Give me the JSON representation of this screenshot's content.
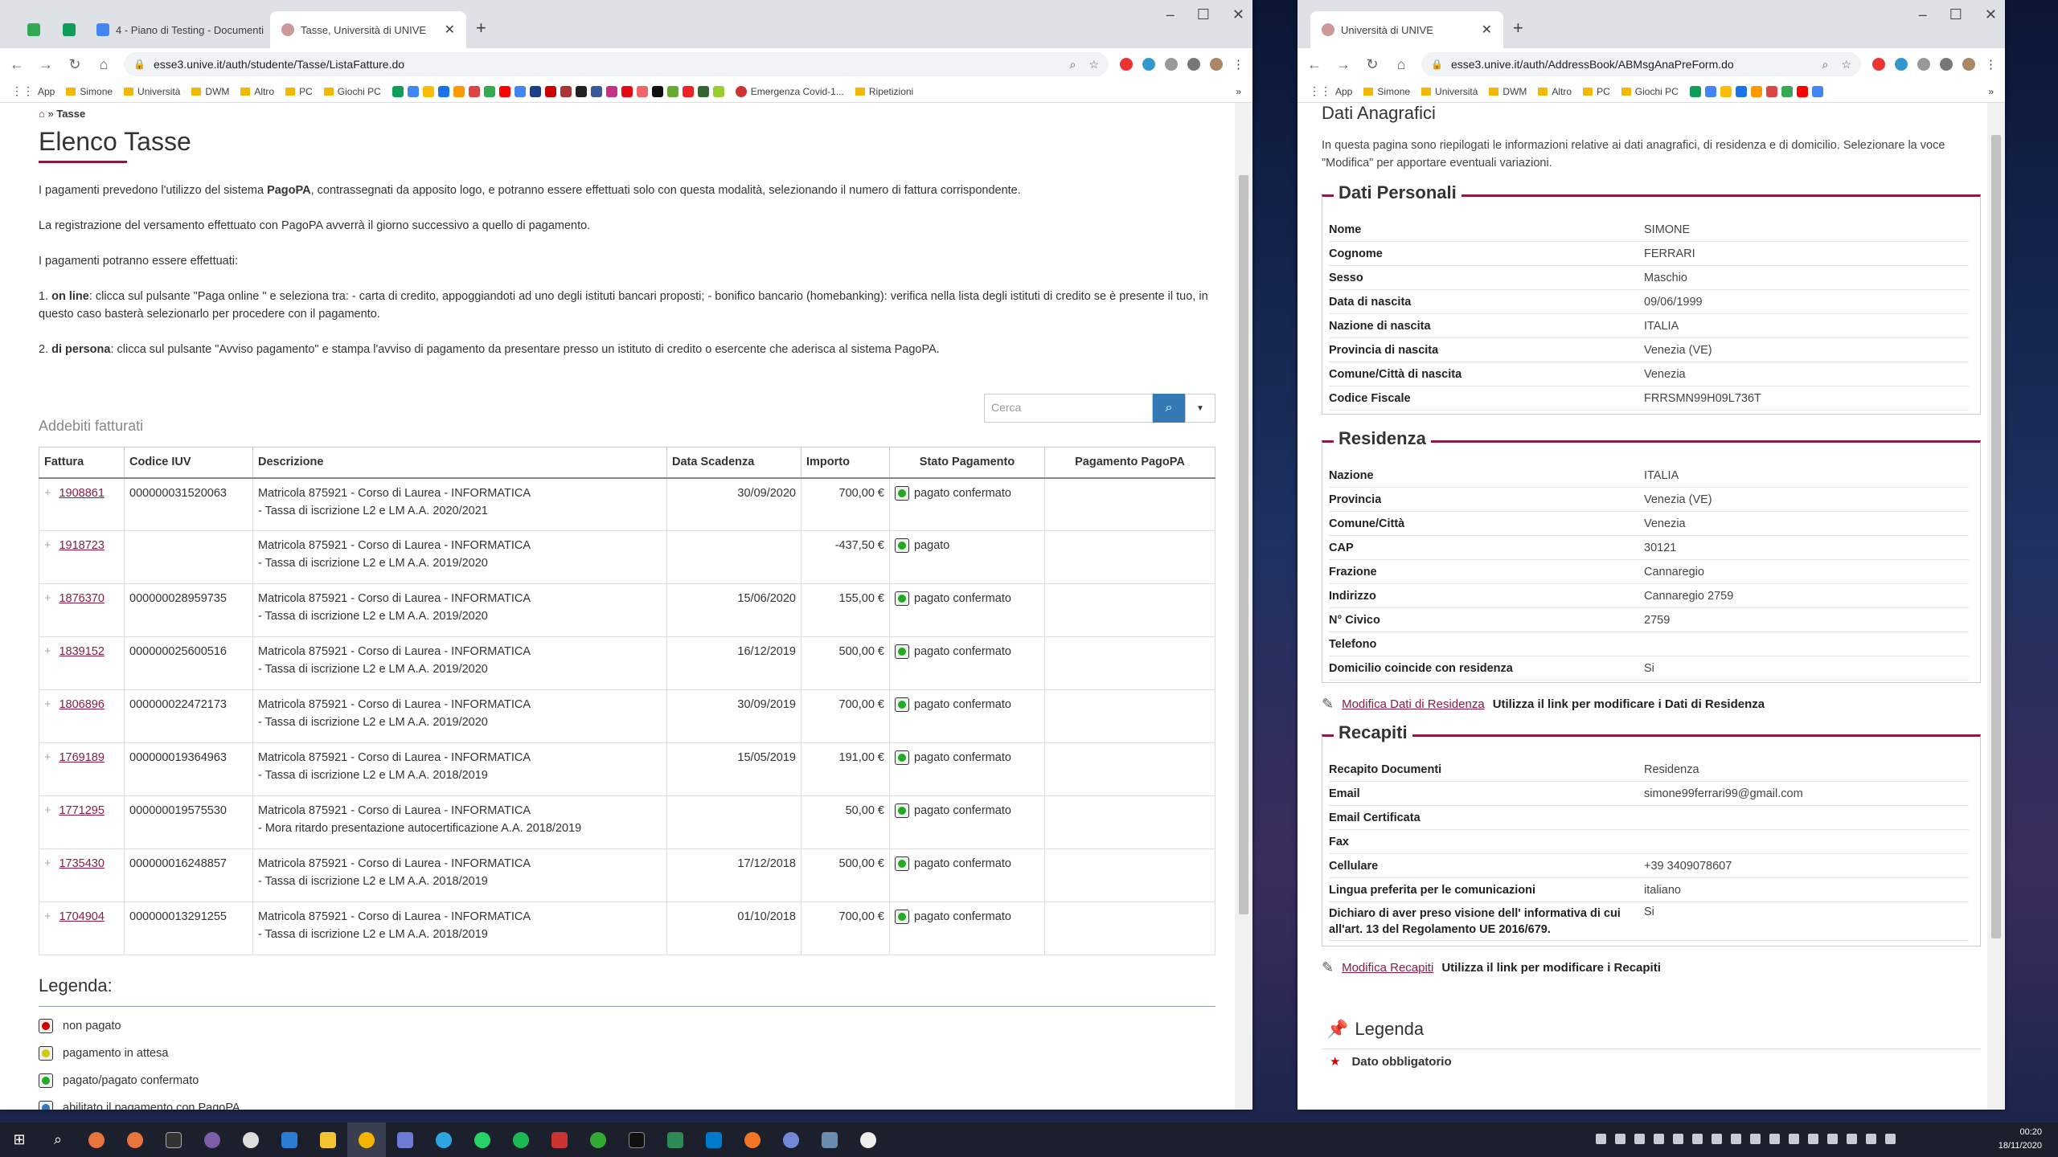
{
  "left_browser": {
    "tabs": [
      {
        "label": "4 - Piano di Testing - Documenti"
      },
      {
        "label": "Tasse, Università di UNIVE",
        "active": true
      }
    ],
    "url": "esse3.unive.it/auth/studente/Tasse/ListaFatture.do",
    "bookmarks": [
      "App",
      "Simone",
      "Università",
      "DWM",
      "Altro",
      "PC",
      "Giochi PC",
      "Emergenza Covid-1...",
      "Ripetizioni"
    ],
    "page": {
      "breadcrumb_current": "Tasse",
      "title": "Elenco Tasse",
      "intro_1a": "I pagamenti prevedono l'utilizzo del sistema ",
      "intro_1b": "PagoPA",
      "intro_1c": ", contrassegnati da apposito logo, e potranno essere effettuati solo con questa modalità, selezionando il numero di fattura corrispondente.",
      "intro_2": "La registrazione del versamento effettuato con PagoPA avverrà il giorno successivo a quello di pagamento.",
      "intro_3": "I pagamenti potranno essere effettuati:",
      "intro_4a": "1. ",
      "intro_4b": "on line",
      "intro_4c": ": clicca sul pulsante \"Paga online \" e seleziona tra: - carta di credito, appoggiandoti ad uno degli istituti bancari proposti; - bonifico bancario (homebanking): verifica nella lista degli istituti di credito se è presente il tuo, in questo caso basterà selezionarlo per procedere con il pagamento.",
      "intro_5a": "2. ",
      "intro_5b": "di persona",
      "intro_5c": ": clicca sul pulsante \"Avviso pagamento\" e stampa l'avviso di pagamento da presentare presso un istituto di credito o esercente che aderisca al sistema PagoPA.",
      "section_title": "Addebiti fatturati",
      "search_placeholder": "Cerca",
      "columns": [
        "Fattura",
        "Codice IUV",
        "Descrizione",
        "Data Scadenza",
        "Importo",
        "Stato Pagamento",
        "Pagamento PagoPA"
      ],
      "rows": [
        {
          "fattura": "1908861",
          "iuv": "000000031520063",
          "d1": "Matricola 875921 - Corso di Laurea - INFORMATICA",
          "d2": "- Tassa di iscrizione L2 e LM A.A. 2020/2021",
          "scad": "30/09/2020",
          "imp": "700,00 €",
          "stato": "pagato confermato"
        },
        {
          "fattura": "1918723",
          "iuv": "",
          "d1": "Matricola 875921 - Corso di Laurea - INFORMATICA",
          "d2": "- Tassa di iscrizione L2 e LM A.A. 2019/2020",
          "scad": "",
          "imp": "-437,50 €",
          "stato": "pagato"
        },
        {
          "fattura": "1876370",
          "iuv": "000000028959735",
          "d1": "Matricola 875921 - Corso di Laurea - INFORMATICA",
          "d2": "- Tassa di iscrizione L2 e LM A.A. 2019/2020",
          "scad": "15/06/2020",
          "imp": "155,00 €",
          "stato": "pagato confermato"
        },
        {
          "fattura": "1839152",
          "iuv": "000000025600516",
          "d1": "Matricola 875921 - Corso di Laurea - INFORMATICA",
          "d2": "- Tassa di iscrizione L2 e LM A.A. 2019/2020",
          "scad": "16/12/2019",
          "imp": "500,00 €",
          "stato": "pagato confermato"
        },
        {
          "fattura": "1806896",
          "iuv": "000000022472173",
          "d1": "Matricola 875921 - Corso di Laurea - INFORMATICA",
          "d2": "- Tassa di iscrizione L2 e LM A.A. 2019/2020",
          "scad": "30/09/2019",
          "imp": "700,00 €",
          "stato": "pagato confermato"
        },
        {
          "fattura": "1769189",
          "iuv": "000000019364963",
          "d1": "Matricola 875921 - Corso di Laurea - INFORMATICA",
          "d2": "- Tassa di iscrizione L2 e LM A.A. 2018/2019",
          "scad": "15/05/2019",
          "imp": "191,00 €",
          "stato": "pagato confermato"
        },
        {
          "fattura": "1771295",
          "iuv": "000000019575530",
          "d1": "Matricola 875921 - Corso di Laurea - INFORMATICA",
          "d2": "- Mora ritardo presentazione autocertificazione A.A. 2018/2019",
          "scad": "",
          "imp": "50,00 €",
          "stato": "pagato confermato"
        },
        {
          "fattura": "1735430",
          "iuv": "000000016248857",
          "d1": "Matricola 875921 - Corso di Laurea - INFORMATICA",
          "d2": "- Tassa di iscrizione L2 e LM A.A. 2018/2019",
          "scad": "17/12/2018",
          "imp": "500,00 €",
          "stato": "pagato confermato"
        },
        {
          "fattura": "1704904",
          "iuv": "000000013291255",
          "d1": "Matricola 875921 - Corso di Laurea - INFORMATICA",
          "d2": "- Tassa di iscrizione L2 e LM A.A. 2018/2019",
          "scad": "01/10/2018",
          "imp": "700,00 €",
          "stato": "pagato confermato"
        }
      ],
      "legend_title": "Legenda:",
      "legend": [
        "non pagato",
        "pagamento in attesa",
        "pagato/pagato confermato",
        "abilitato il pagamento con PagoPA"
      ]
    }
  },
  "right_browser": {
    "tab": "Università di UNIVE",
    "url": "esse3.unive.it/auth/AddressBook/ABMsgAnaPreForm.do",
    "bookmarks": [
      "App",
      "Simone",
      "Università",
      "DWM",
      "Altro",
      "PC",
      "Giochi PC"
    ],
    "page": {
      "title": "Dati Anagrafici",
      "intro": "In questa pagina sono riepilogati le informazioni relative ai dati anagrafici, di residenza e di domicilio. Selezionare la voce \"Modifica\" per apportare eventuali variazioni.",
      "personali_title": "Dati Personali",
      "personali": [
        [
          "Nome",
          "SIMONE"
        ],
        [
          "Cognome",
          "FERRARI"
        ],
        [
          "Sesso",
          "Maschio"
        ],
        [
          "Data di nascita",
          "09/06/1999"
        ],
        [
          "Nazione di nascita",
          "ITALIA"
        ],
        [
          "Provincia di nascita",
          "Venezia (VE)"
        ],
        [
          "Comune/Città di nascita",
          "Venezia"
        ],
        [
          "Codice Fiscale",
          "FRRSMN99H09L736T"
        ]
      ],
      "residenza_title": "Residenza",
      "residenza": [
        [
          "Nazione",
          "ITALIA"
        ],
        [
          "Provincia",
          "Venezia (VE)"
        ],
        [
          "Comune/Città",
          "Venezia"
        ],
        [
          "CAP",
          "30121"
        ],
        [
          "Frazione",
          "Cannaregio"
        ],
        [
          "Indirizzo",
          "Cannaregio 2759"
        ],
        [
          "N° Civico",
          "2759"
        ],
        [
          "Telefono",
          ""
        ],
        [
          "Domicilio coincide con residenza",
          "Si"
        ]
      ],
      "mod_res_link": "Modifica Dati di Residenza",
      "mod_res_text": "Utilizza il link per modificare i Dati di Residenza",
      "recapiti_title": "Recapiti",
      "recapiti": [
        [
          "Recapito Documenti",
          "Residenza"
        ],
        [
          "Email",
          "simone99ferrari99@gmail.com"
        ],
        [
          "Email Certificata",
          ""
        ],
        [
          "Fax",
          ""
        ],
        [
          "Cellulare",
          "+39 3409078607"
        ],
        [
          "Lingua preferita per le comunicazioni",
          "italiano"
        ],
        [
          "Dichiaro di aver preso visione dell' informativa di cui all'art. 13 del Regolamento UE 2016/679.",
          "Si"
        ]
      ],
      "mod_rec_link": "Modifica Recapiti",
      "mod_rec_text": "Utilizza il link per modificare i Recapiti",
      "legenda_title": "Legenda",
      "legenda_item": "Dato obbligatorio"
    }
  },
  "taskbar": {
    "time": "00:20",
    "date": "18/11/2020"
  },
  "colors": {
    "accent": "#8c1b3f",
    "link": "#8c1b3f",
    "search_btn": "#337ab7"
  }
}
